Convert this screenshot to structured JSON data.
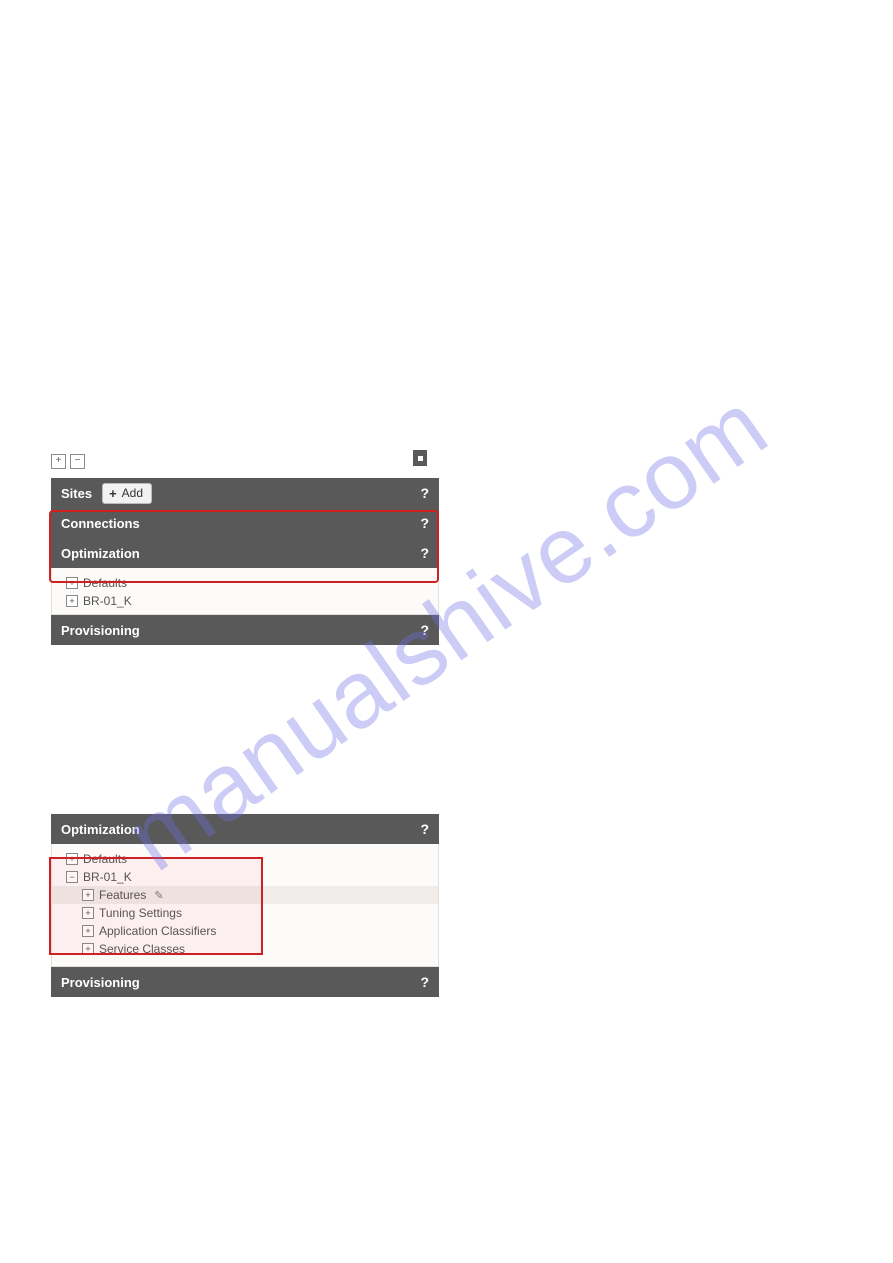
{
  "watermark": "manualshive.com",
  "panel1": {
    "sites": {
      "label": "Sites",
      "add_btn": "Add"
    },
    "connections": {
      "label": "Connections"
    },
    "optimization": {
      "label": "Optimization",
      "items": [
        {
          "label": "Defaults"
        },
        {
          "label": "BR-01_K"
        }
      ]
    },
    "provisioning": {
      "label": "Provisioning"
    },
    "help": "?"
  },
  "panel2": {
    "optimization": {
      "label": "Optimization",
      "items": [
        {
          "label": "Defaults",
          "expanded": false
        },
        {
          "label": "BR-01_K",
          "expanded": true,
          "children": [
            {
              "label": "Features",
              "highlighted": true,
              "editable": true
            },
            {
              "label": "Tuning Settings"
            },
            {
              "label": "Application Classifiers"
            },
            {
              "label": "Service Classes"
            }
          ]
        }
      ]
    },
    "provisioning": {
      "label": "Provisioning"
    },
    "help": "?"
  },
  "icons": {
    "plus": "+",
    "minus": "−",
    "pencil": "✎"
  }
}
